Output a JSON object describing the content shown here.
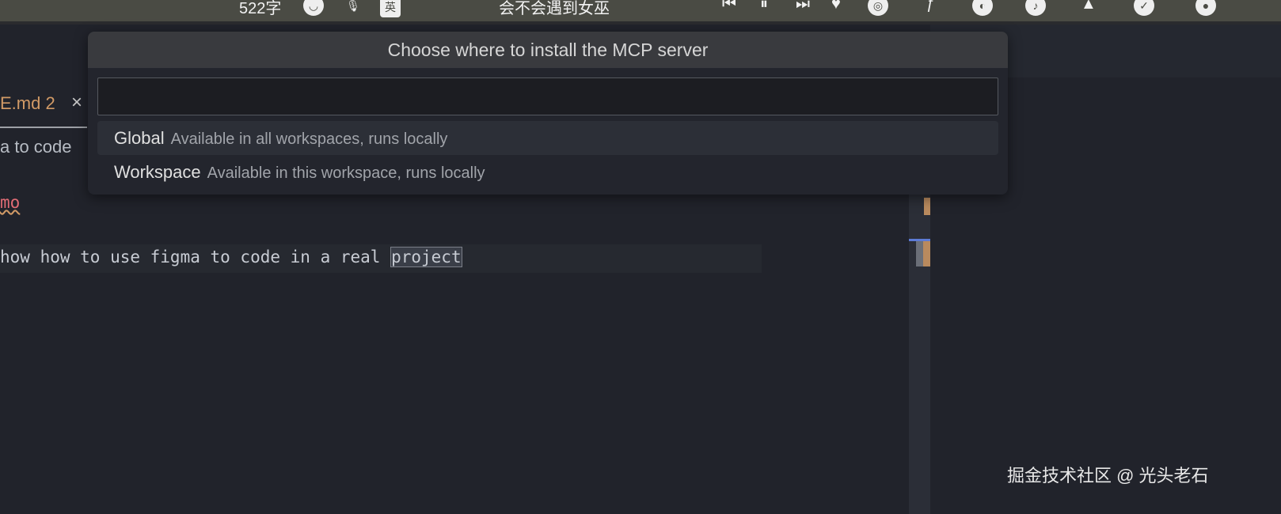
{
  "menubar": {
    "word_count": "522字",
    "input_method": "英",
    "now_playing": "会不会遇到女巫",
    "icons": [
      "smiley-icon",
      "microphone-icon",
      "input-method-icon",
      "previous-track-icon",
      "pause-icon",
      "next-track-icon",
      "heart-icon",
      "target-icon",
      "figma-icon",
      "app-icon",
      "music-icon",
      "vlc-icon",
      "check-icon",
      "wechat-icon"
    ]
  },
  "editor": {
    "tab_label": "E.md",
    "tab_problems": "2",
    "tab_close": "×",
    "breadcrumb": "a to code",
    "heading_fragment": "mo",
    "code_before": "how how to use figma to code in a real ",
    "code_selected": "project"
  },
  "quick_pick": {
    "title": "Choose where to install the MCP server",
    "input_value": "",
    "input_placeholder": "",
    "options": [
      {
        "label": "Global",
        "description": "Available in all workspaces, runs locally"
      },
      {
        "label": "Workspace",
        "description": "Available in this workspace, runs locally"
      }
    ]
  },
  "watermark": "掘金技术社区 @ 光头老石"
}
